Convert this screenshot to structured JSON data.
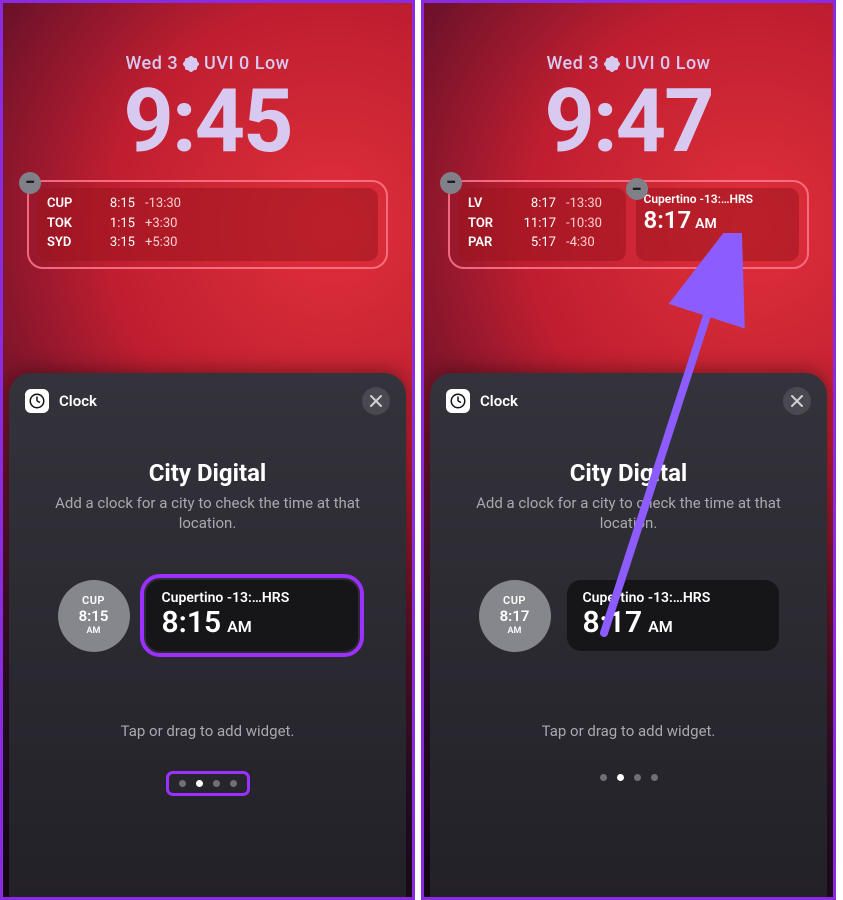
{
  "left": {
    "dateline": "Wed 3",
    "uvline": "UVI 0 Low",
    "bigtime": "9:45",
    "worldclock": {
      "rows": [
        {
          "city": "CUP",
          "time": "8:15",
          "offset": "-13:30"
        },
        {
          "city": "TOK",
          "time": "1:15",
          "offset": "+3:30"
        },
        {
          "city": "SYD",
          "time": "3:15",
          "offset": "+5:30"
        }
      ]
    },
    "sheet": {
      "app": "Clock",
      "heading": "City Digital",
      "sub": "Add a clock for a city to check the time at that location.",
      "hint": "Tap or drag to add widget.",
      "small": {
        "city": "CUP",
        "time": "8:15",
        "ampm": "AM"
      },
      "card": {
        "label": "Cupertino -13:…HRS",
        "time": "8:15",
        "ampm": "AM"
      },
      "pager_active": 1
    }
  },
  "right": {
    "dateline": "Wed 3",
    "uvline": "UVI 0 Low",
    "bigtime": "9:47",
    "worldclock": {
      "rows": [
        {
          "city": "LV",
          "time": "8:17",
          "offset": "-13:30"
        },
        {
          "city": "TOR",
          "time": "11:17",
          "offset": "-10:30"
        },
        {
          "city": "PAR",
          "time": "5:17",
          "offset": "-4:30"
        }
      ]
    },
    "single_widget": {
      "label": "Cupertino -13:…HRS",
      "time": "8:17",
      "ampm": "AM"
    },
    "sheet": {
      "app": "Clock",
      "heading": "City Digital",
      "sub": "Add a clock for a city to check the time at that location.",
      "hint": "Tap or drag to add widget.",
      "small": {
        "city": "CUP",
        "time": "8:17",
        "ampm": "AM"
      },
      "card": {
        "label": "Cupertino -13:…HRS",
        "time": "8:17",
        "ampm": "AM"
      },
      "pager_active": 1
    }
  },
  "minus_glyph": "−"
}
